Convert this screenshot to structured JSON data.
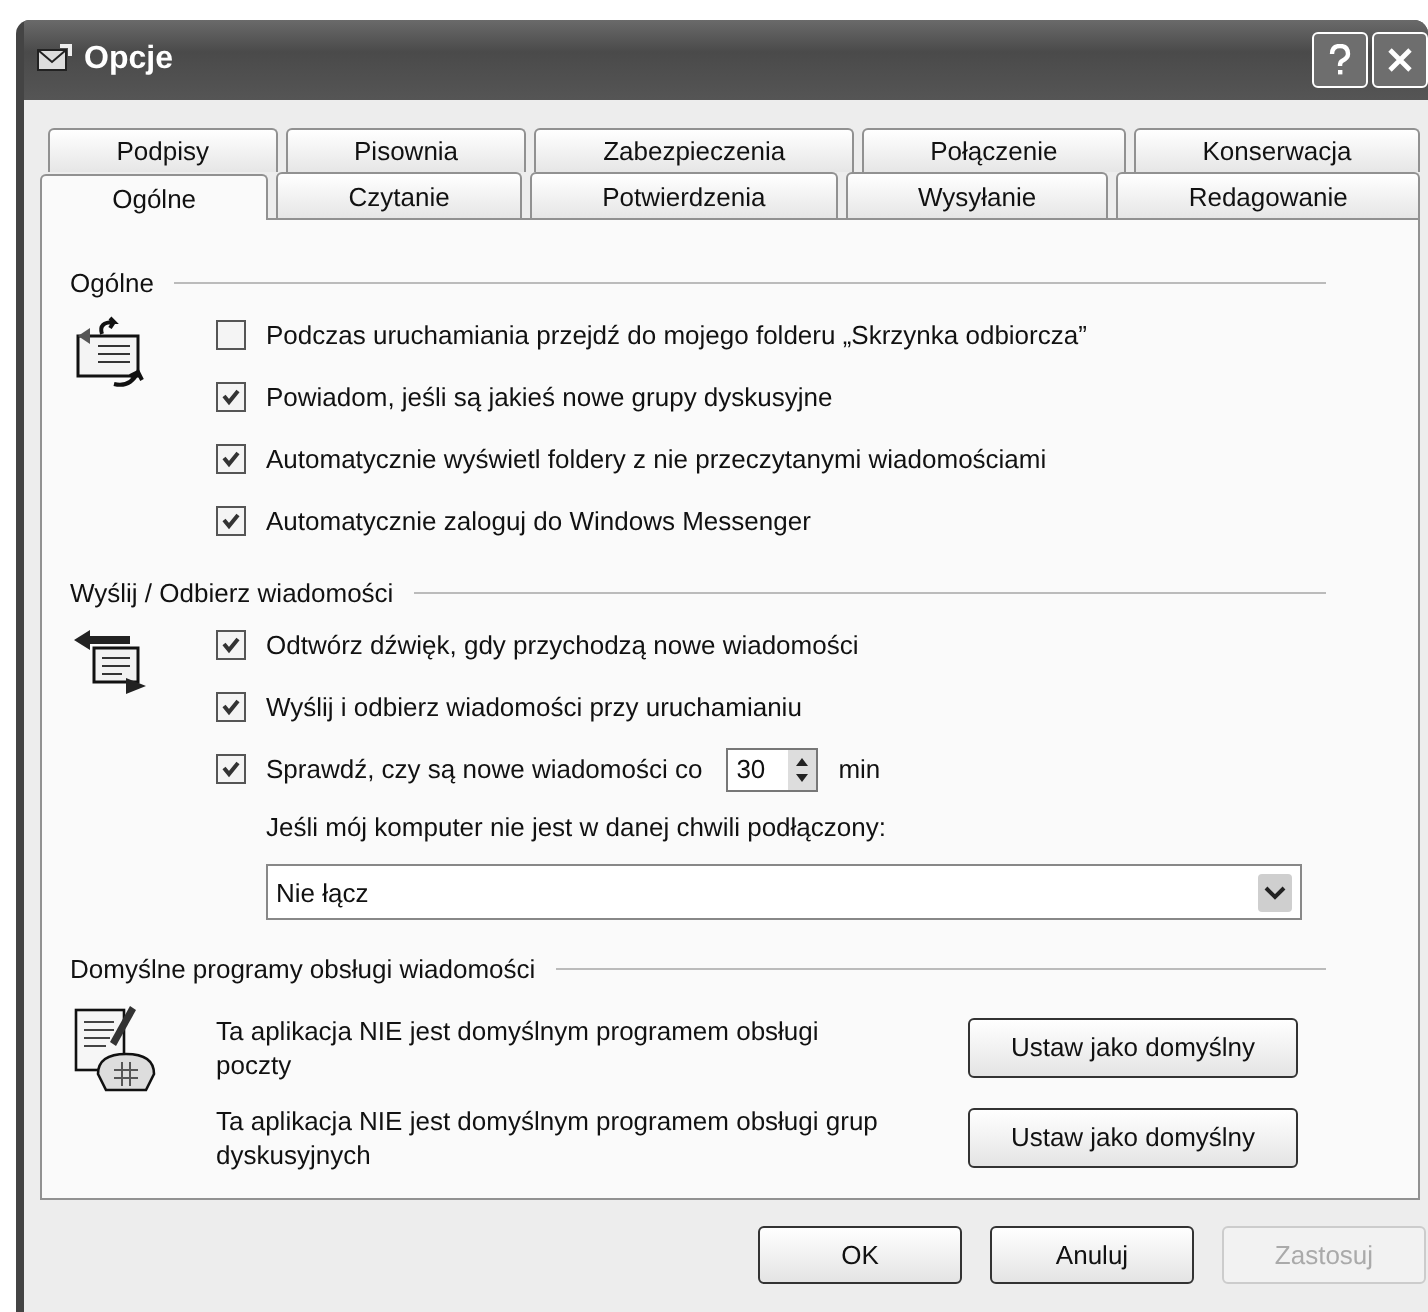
{
  "window": {
    "title": "Opcje"
  },
  "tab_rows": [
    [
      {
        "label": "Podpisy",
        "selected": false
      },
      {
        "label": "Pisownia",
        "selected": false
      },
      {
        "label": "Zabezpieczenia",
        "selected": false
      },
      {
        "label": "Połączenie",
        "selected": false
      },
      {
        "label": "Konserwacja",
        "selected": false
      }
    ],
    [
      {
        "label": "Ogólne",
        "selected": true
      },
      {
        "label": "Czytanie",
        "selected": false
      },
      {
        "label": "Potwierdzenia",
        "selected": false
      },
      {
        "label": "Wysyłanie",
        "selected": false
      },
      {
        "label": "Redagowanie",
        "selected": false
      }
    ]
  ],
  "sections": [
    {
      "title": "Ogólne",
      "kind": "mail",
      "items": [
        {
          "kind": "checkbox",
          "label": "Podczas uruchamiania przejdź do mojego folderu „Skrzynka odbiorcza”",
          "checked": false
        },
        {
          "kind": "checkbox",
          "label": "Powiadom, jeśli są jakieś nowe grupy dyskusyjne",
          "checked": true
        },
        {
          "kind": "checkbox",
          "label": "Automatycznie wyświetl foldery z nie przeczytanymi wiadomościami",
          "checked": true
        },
        {
          "kind": "checkbox",
          "label": "Automatycznie zaloguj do Windows Messenger",
          "checked": true
        }
      ]
    },
    {
      "title": "Wyślij / Odbierz wiadomości",
      "kind": "sendrecv",
      "items": [
        {
          "kind": "checkbox",
          "label": "Odtwórz dźwięk, gdy przychodzą nowe wiadomości",
          "checked": true
        },
        {
          "kind": "checkbox",
          "label": "Wyślij i odbierz wiadomości przy uruchamianiu",
          "checked": true
        },
        {
          "kind": "spin",
          "label": "Sprawdź, czy są nowe wiadomości co",
          "checked": true,
          "value": "30",
          "unit": "min"
        },
        {
          "kind": "note",
          "text": "Jeśli mój komputer nie jest w danej chwili podłączony:"
        },
        {
          "kind": "dropdown",
          "value": "Nie łącz"
        }
      ]
    },
    {
      "title": "Domyślne programy obsługi wiadomości",
      "kind": "phone",
      "items": [
        {
          "kind": "default",
          "text": "Ta aplikacja NIE jest domyślnym programem obsługi poczty",
          "button": "Ustaw jako domyślny"
        },
        {
          "kind": "default",
          "text": "Ta aplikacja NIE jest domyślnym programem obsługi grup dyskusyjnych",
          "button": "Ustaw jako domyślny"
        }
      ]
    }
  ],
  "buttons": [
    {
      "label": "OK",
      "disabled": false
    },
    {
      "label": "Anuluj",
      "disabled": false
    },
    {
      "label": "Zastosuj",
      "disabled": true
    }
  ]
}
